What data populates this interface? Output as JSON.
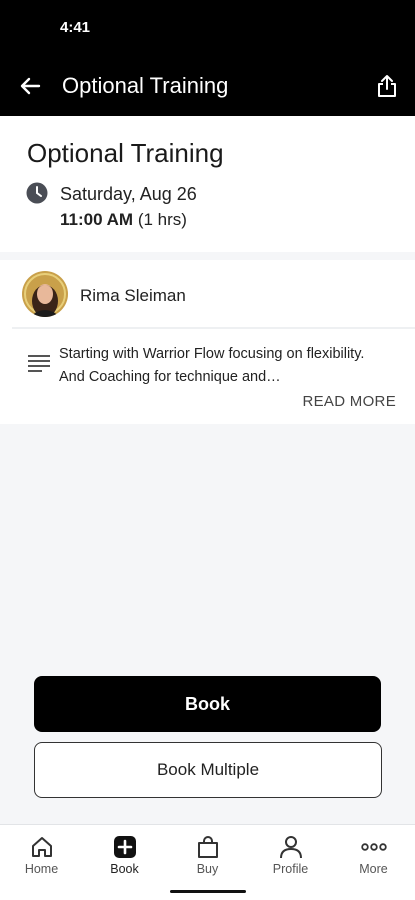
{
  "status_bar": {
    "time": "4:41"
  },
  "app_bar": {
    "title": "Optional Training"
  },
  "event": {
    "title": "Optional Training",
    "date": "Saturday, Aug 26",
    "time": "11:00 AM",
    "duration": "(1 hrs)"
  },
  "instructor": {
    "name": "Rima Sleiman"
  },
  "description": {
    "text": "Starting with Warrior Flow focusing on flexibility. And Coaching for technique and…",
    "read_more": "READ MORE"
  },
  "actions": {
    "book": "Book",
    "book_multiple": "Book Multiple"
  },
  "bottom_nav": {
    "items": [
      {
        "label": "Home",
        "icon": "home-icon"
      },
      {
        "label": "Book",
        "icon": "plus-square-icon"
      },
      {
        "label": "Buy",
        "icon": "shopping-bag-icon"
      },
      {
        "label": "Profile",
        "icon": "person-icon"
      },
      {
        "label": "More",
        "icon": "more-dots-icon"
      }
    ]
  },
  "colors": {
    "primary": "#000000",
    "background": "#f5f6f8",
    "surface": "#ffffff"
  }
}
